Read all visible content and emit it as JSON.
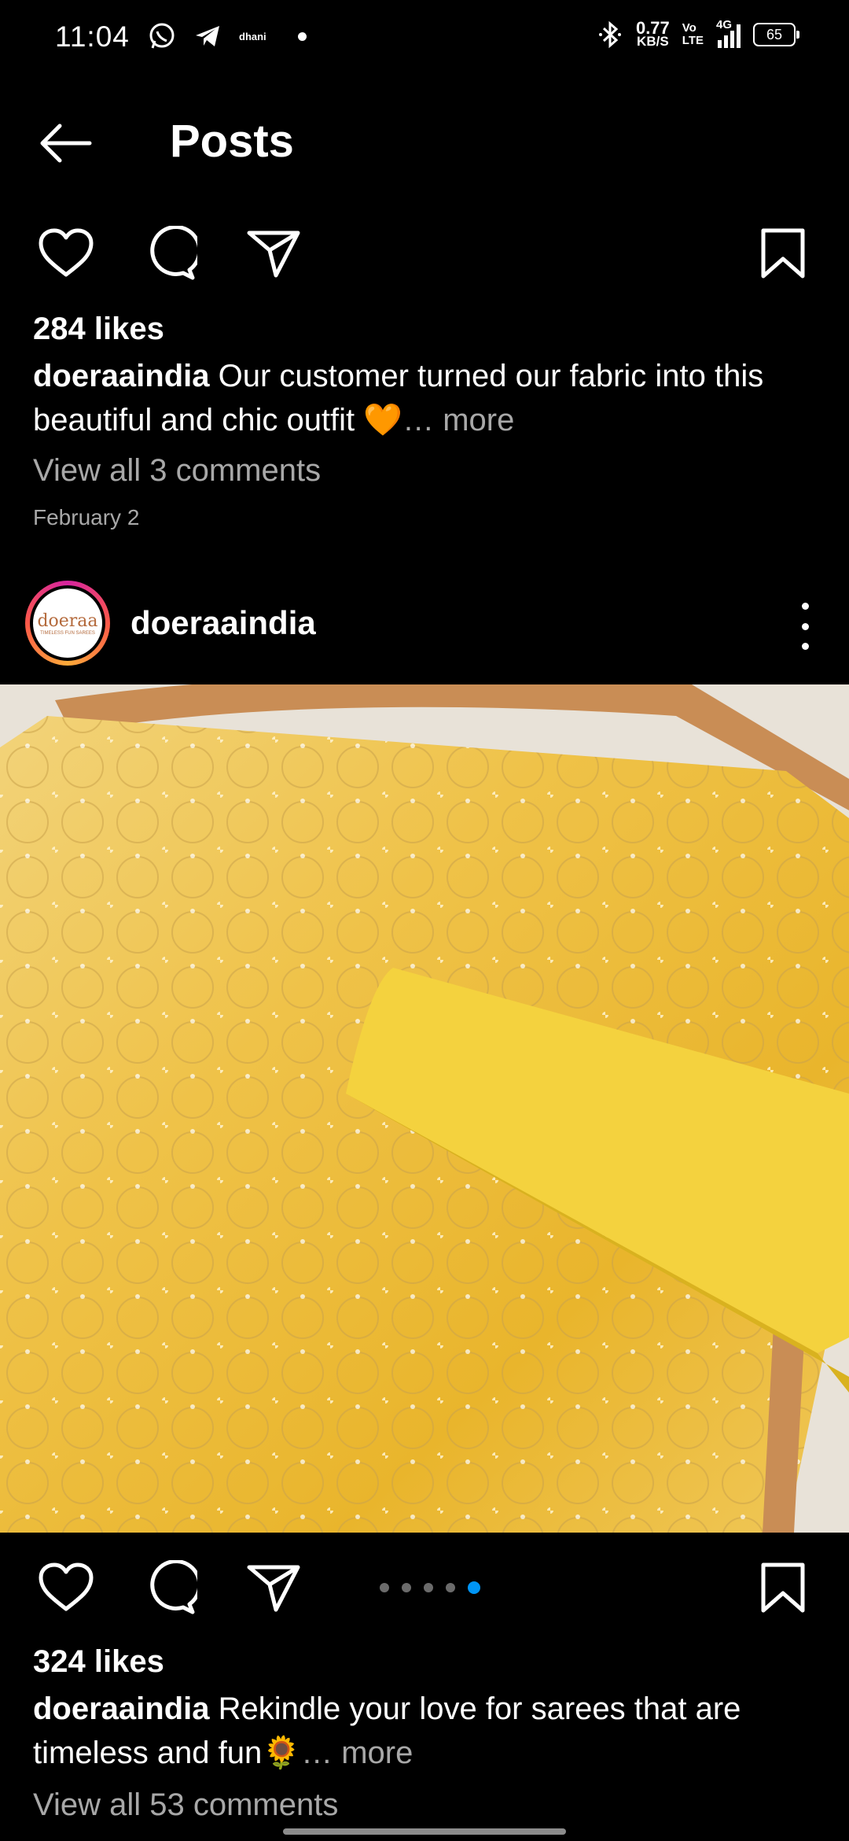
{
  "status_bar": {
    "time": "11:04",
    "carrier_text": "dhani",
    "speed_value": "0.77",
    "speed_unit": "KB/S",
    "volte_top": "Vo",
    "volte_bottom": "LTE",
    "network": "4G",
    "battery": "65"
  },
  "header": {
    "title": "Posts"
  },
  "post1": {
    "likes": "284 likes",
    "username": "doeraaindia",
    "caption": "Our customer turned our fabric into this beautiful and chic outfit 🧡",
    "more": "… more",
    "comments": "View all 3 comments",
    "date": "February 2"
  },
  "post2": {
    "username": "doeraaindia",
    "avatar_logo": "doeraa",
    "avatar_tagline": "TIMELESS FUN SAREES",
    "carousel": {
      "count": 5,
      "active_index": 4
    },
    "likes": "324 likes",
    "caption": "Rekindle your love for sarees that are timeless and fun🌻",
    "more": "… more",
    "comments": "View all 53 comments"
  },
  "colors": {
    "accent": "#0095f6",
    "muted": "#a8a8a8",
    "background": "#000000"
  },
  "icons": [
    "back-arrow-icon",
    "heart-icon",
    "comment-icon",
    "share-icon",
    "bookmark-icon",
    "more-options-icon"
  ]
}
